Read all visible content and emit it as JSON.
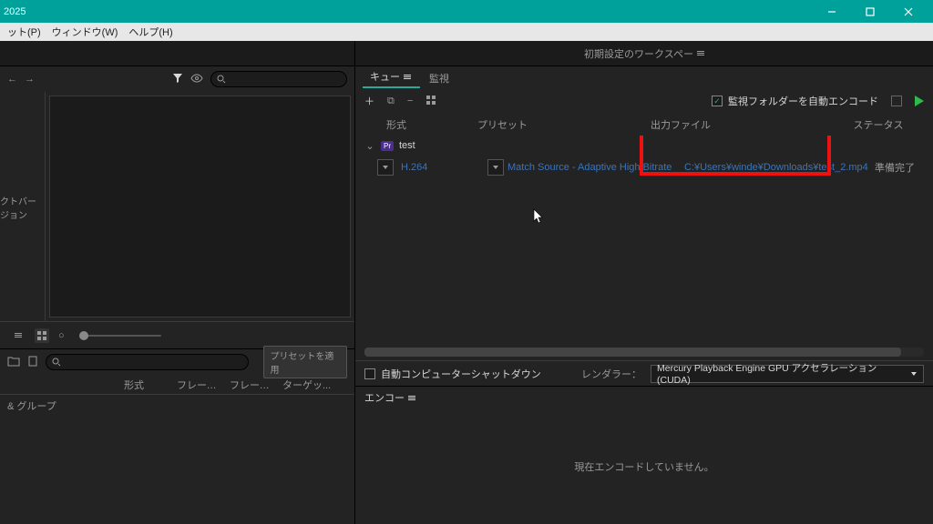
{
  "titlebar": {
    "year": "2025"
  },
  "menu": {
    "preset": "ット(P)",
    "window": "ウィンドウ(W)",
    "help": "ヘルプ(H)"
  },
  "workspace": {
    "label": "初期設定のワークスペー"
  },
  "leftTop": {
    "sidebarLabel": "クトバージョン",
    "searchPlaceholder": ""
  },
  "presets": {
    "applyBtn": "プリセットを適用",
    "head": {
      "name": "",
      "format": "形式",
      "frame1": "フレーム...",
      "frame2": "フレーム...",
      "target": "ターゲッ..."
    },
    "rows": [
      "& グループ",
      "",
      ""
    ]
  },
  "queue": {
    "tabs": {
      "queue": "キュー",
      "watch": "監視"
    },
    "autoEncode": "監視フォルダーを自動エンコード",
    "head": {
      "format": "形式",
      "preset": "プリセット",
      "output": "出力ファイル",
      "status": "ステータス"
    },
    "group": {
      "name": "test",
      "app": "Pr"
    },
    "row": {
      "format": "H.264",
      "preset": "Match Source - Adaptive High Bitrate",
      "output": "C:¥Users¥winde¥Downloads¥test_2.mp4",
      "status": "準備完了"
    },
    "autoShutdown": "自動コンピューターシャットダウン",
    "rendererLabel": "レンダラー：",
    "renderer": "Mercury Playback Engine GPU アクセラレーション (CUDA)"
  },
  "encoding": {
    "tab": "エンコー",
    "status": "現在エンコードしていません。"
  }
}
